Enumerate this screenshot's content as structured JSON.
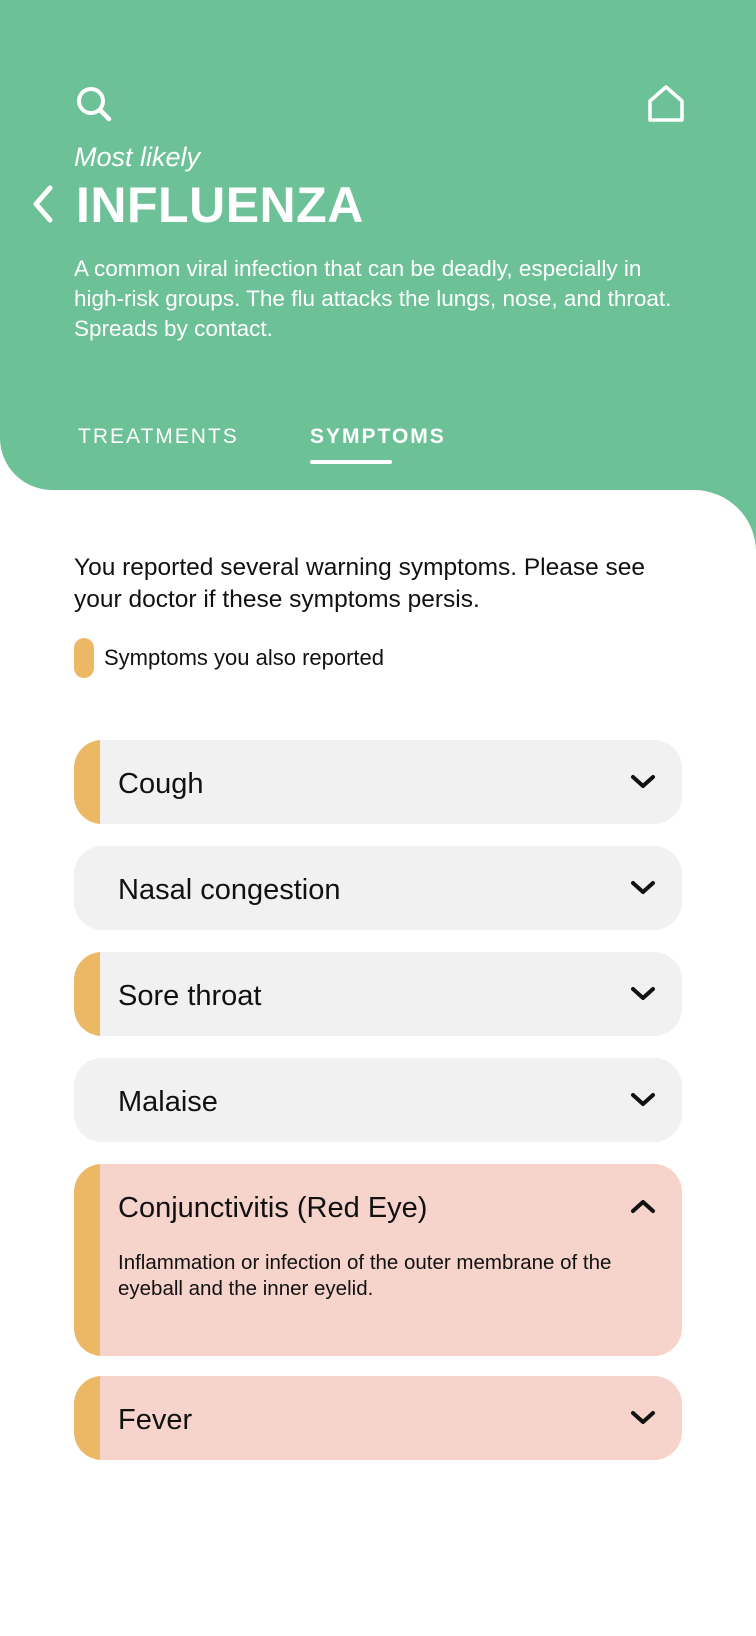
{
  "header": {
    "subtitle": "Most likely",
    "title": "INFLUENZA",
    "description": "A common viral infection that can be deadly, especially in high-risk groups. The flu attacks the lungs, nose, and throat. Spreads by contact.",
    "icons": {
      "search": "search-icon",
      "home": "home-icon",
      "back": "chevron-left-icon"
    }
  },
  "tabs": [
    {
      "label": "TREATMENTS",
      "active": false
    },
    {
      "label": "SYMPTOMS",
      "active": true
    }
  ],
  "intro": "You reported several warning symptoms. Please see your doctor if these symptoms persis.",
  "legend": {
    "label": "Symptoms you also reported",
    "color": "#ecb866"
  },
  "symptoms": [
    {
      "label": "Cough",
      "reported": true,
      "expanded": false
    },
    {
      "label": "Nasal congestion",
      "reported": false,
      "expanded": false
    },
    {
      "label": "Sore throat",
      "reported": true,
      "expanded": false
    },
    {
      "label": "Malaise",
      "reported": false,
      "expanded": false
    },
    {
      "label": "Conjunctivitis (Red Eye)",
      "reported": true,
      "expanded": true,
      "detail": "Inflammation or infection of the outer membrane of the eyeball and the inner eyelid."
    },
    {
      "label": "Fever",
      "reported": true,
      "expanded": false
    }
  ],
  "colors": {
    "header": "#6dc197",
    "accent": "#ecb866",
    "card_default": "#f1f1f1",
    "card_warning": "#f6d3cb"
  }
}
